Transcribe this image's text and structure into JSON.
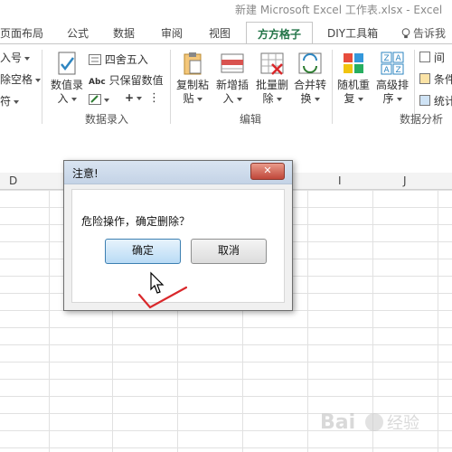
{
  "window": {
    "title": "新建 Microsoft Excel 工作表.xlsx - Excel"
  },
  "tabs": [
    {
      "label": "页面布局"
    },
    {
      "label": "公式"
    },
    {
      "label": "数据"
    },
    {
      "label": "审阅"
    },
    {
      "label": "视图"
    },
    {
      "label": "方方格子",
      "active": true
    },
    {
      "label": "DIY工具箱"
    }
  ],
  "tell_me": "告诉我",
  "ribbon": {
    "left_cut": {
      "row1": "入号",
      "row2": "除空格",
      "row3": "符"
    },
    "data_entry": {
      "big_button": {
        "line1": "数值录",
        "line2": "入"
      },
      "small": [
        "四舍五入",
        "只保留数值"
      ],
      "label": "数据录入"
    },
    "edit": {
      "buttons": [
        {
          "line1": "复制粘",
          "line2": "贴"
        },
        {
          "line1": "新增插",
          "line2": "入"
        },
        {
          "line1": "批量删",
          "line2": "除"
        },
        {
          "line1": "合并转",
          "line2": "换"
        }
      ],
      "label": "编辑"
    },
    "analysis": {
      "buttons": [
        {
          "line1": "随机重",
          "line2": "复"
        },
        {
          "line1": "高级排",
          "line2": "序"
        }
      ],
      "small": [
        "间",
        "条件",
        "统计"
      ],
      "label": "数据分析"
    }
  },
  "sheet": {
    "columns": [
      "D",
      "I",
      "J"
    ]
  },
  "dialog": {
    "title": "注意!",
    "message": "危险操作，确定删除？",
    "ok_label": "确定",
    "cancel_label": "取消"
  },
  "colors": {
    "accent": "#217346",
    "check": "#d9282b"
  }
}
